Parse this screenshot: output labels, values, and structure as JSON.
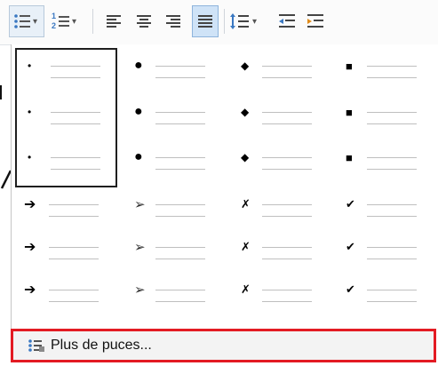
{
  "toolbar": {
    "dropdown_arrow": "▾",
    "buttons": [
      {
        "name": "bullets-button",
        "icon": "bullet-list-icon",
        "has_arrow": true
      },
      {
        "name": "numbering-button",
        "icon": "numbered-list-icon",
        "has_arrow": true
      },
      {
        "name": "align-left-button",
        "icon": "align-left-icon"
      },
      {
        "name": "align-center-button",
        "icon": "align-center-icon"
      },
      {
        "name": "align-right-button",
        "icon": "align-right-icon"
      },
      {
        "name": "justify-button",
        "icon": "justify-icon",
        "active": true
      },
      {
        "name": "line-spacing-button",
        "icon": "line-spacing-icon",
        "has_arrow": true
      },
      {
        "name": "decrease-indent-button",
        "icon": "decrease-indent-icon"
      },
      {
        "name": "increase-indent-button",
        "icon": "increase-indent-icon"
      }
    ]
  },
  "numbering_digits": [
    "1",
    "2"
  ],
  "gallery": {
    "bullet_types": [
      {
        "name": "small-dot-bullet",
        "glyph": "•"
      },
      {
        "name": "large-dot-bullet",
        "glyph": "●"
      },
      {
        "name": "diamond-bullet",
        "glyph": "◆"
      },
      {
        "name": "square-bullet",
        "glyph": "■"
      },
      {
        "name": "bold-arrow-bullet",
        "glyph": "➔"
      },
      {
        "name": "arrowhead-bullet",
        "glyph": "➢"
      },
      {
        "name": "cross-bullet",
        "glyph": "✗"
      },
      {
        "name": "checkmark-bullet",
        "glyph": "✔"
      }
    ],
    "selected_index": 0
  },
  "footer": {
    "label": "Plus de puces...",
    "icon": "bullets-library-icon",
    "highlight_color": "#e31b23"
  },
  "colors": {
    "accent": "#cfe3f7",
    "accent_border": "#8eb4dc",
    "list_icon_blue": "#3a78c2"
  }
}
